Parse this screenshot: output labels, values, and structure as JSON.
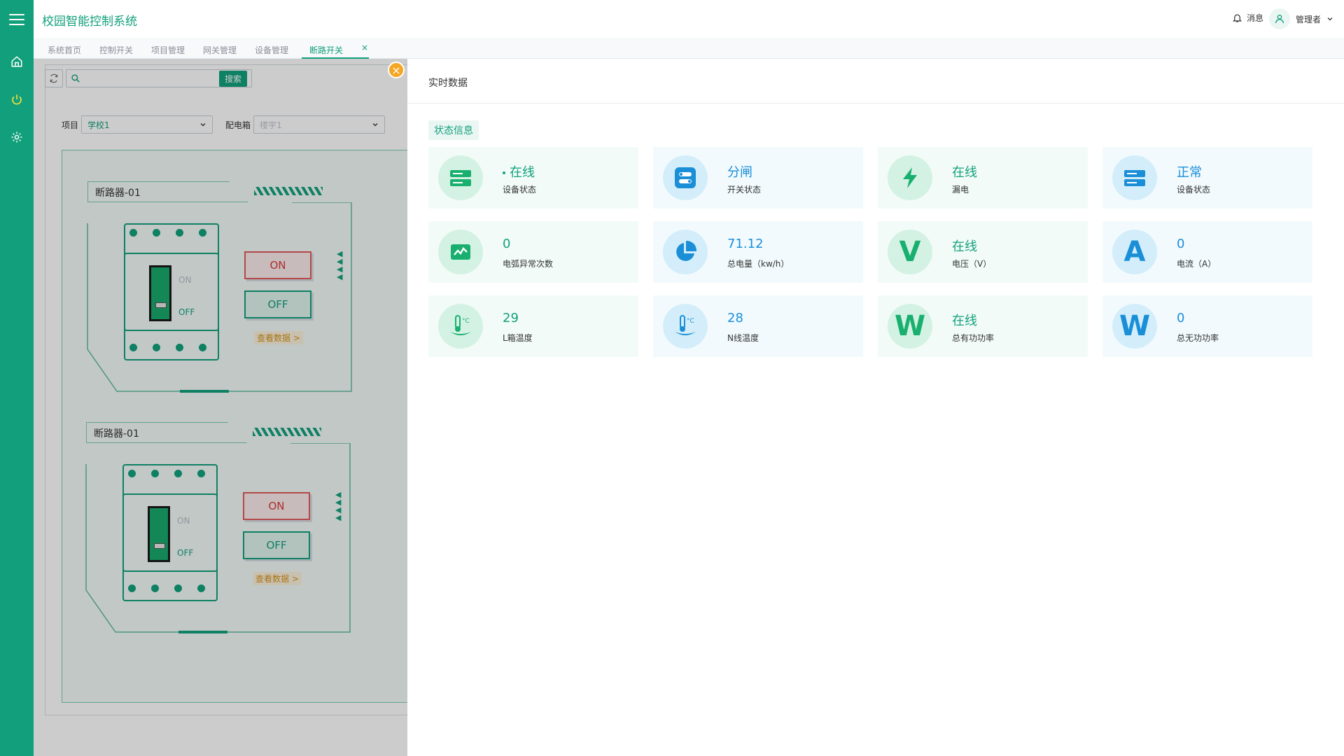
{
  "app": {
    "title": "校园智能控制系统"
  },
  "header": {
    "messages_label": "消息",
    "user_name": "管理者"
  },
  "tabs": [
    {
      "label": "系统首页",
      "active": false
    },
    {
      "label": "控制开关",
      "active": false
    },
    {
      "label": "项目管理",
      "active": false
    },
    {
      "label": "网关管理",
      "active": false
    },
    {
      "label": "设备管理",
      "active": false
    },
    {
      "label": "断路开关",
      "active": true,
      "close": "×"
    }
  ],
  "toolbar": {
    "search_placeholder": "",
    "search_button": "搜索"
  },
  "filters": {
    "project_label": "项目",
    "project_value": "学校1",
    "box_label": "配电箱",
    "box_placeholder": "楼宇1"
  },
  "breakers": [
    {
      "name": "断路器-01",
      "on_text": "ON",
      "off_text": "OFF",
      "lever_on": "ON",
      "lever_off": "OFF",
      "view_link": "查看数据 >"
    },
    {
      "name": "断路器-01",
      "on_text": "ON",
      "off_text": "OFF",
      "lever_on": "ON",
      "lever_off": "OFF",
      "view_link": "查看数据 >"
    }
  ],
  "drawer": {
    "title": "实时数据",
    "section": "状态信息",
    "cards": [
      {
        "value": "在线",
        "label": "设备状态",
        "icon": "server-icon",
        "theme": "green",
        "dot": true
      },
      {
        "value": "分闸",
        "label": "开关状态",
        "icon": "toggle-icon",
        "theme": "blue"
      },
      {
        "value": "在线",
        "label": "漏电",
        "icon": "lightning-icon",
        "theme": "green"
      },
      {
        "value": "正常",
        "label": "设备状态",
        "icon": "server-icon",
        "theme": "blue"
      },
      {
        "value": "0",
        "label": "电弧异常次数",
        "icon": "pulse-icon",
        "theme": "green"
      },
      {
        "value": "71.12",
        "label": "总电量（kw/h）",
        "icon": "pie-icon",
        "theme": "blue"
      },
      {
        "value": "在线",
        "label": "电压（V）",
        "icon": "voltage-icon",
        "letter": "V",
        "theme": "green"
      },
      {
        "value": "0",
        "label": "电流（A）",
        "icon": "current-icon",
        "letter": "A",
        "theme": "blue"
      },
      {
        "value": "29",
        "label": "L箱温度",
        "icon": "thermometer-icon",
        "theme": "green"
      },
      {
        "value": "28",
        "label": "N线温度",
        "icon": "thermometer-icon",
        "theme": "blue"
      },
      {
        "value": "在线",
        "label": "总有功功率",
        "icon": "active-power-icon",
        "letter": "W",
        "theme": "green"
      },
      {
        "value": "0",
        "label": "总无功功率",
        "icon": "reactive-power-icon",
        "letter": "W",
        "theme": "blue"
      }
    ]
  },
  "colors": {
    "brand": "#12a07c",
    "blue": "#1a8fd8",
    "danger": "#d83a3a",
    "warning": "#f5a623"
  }
}
